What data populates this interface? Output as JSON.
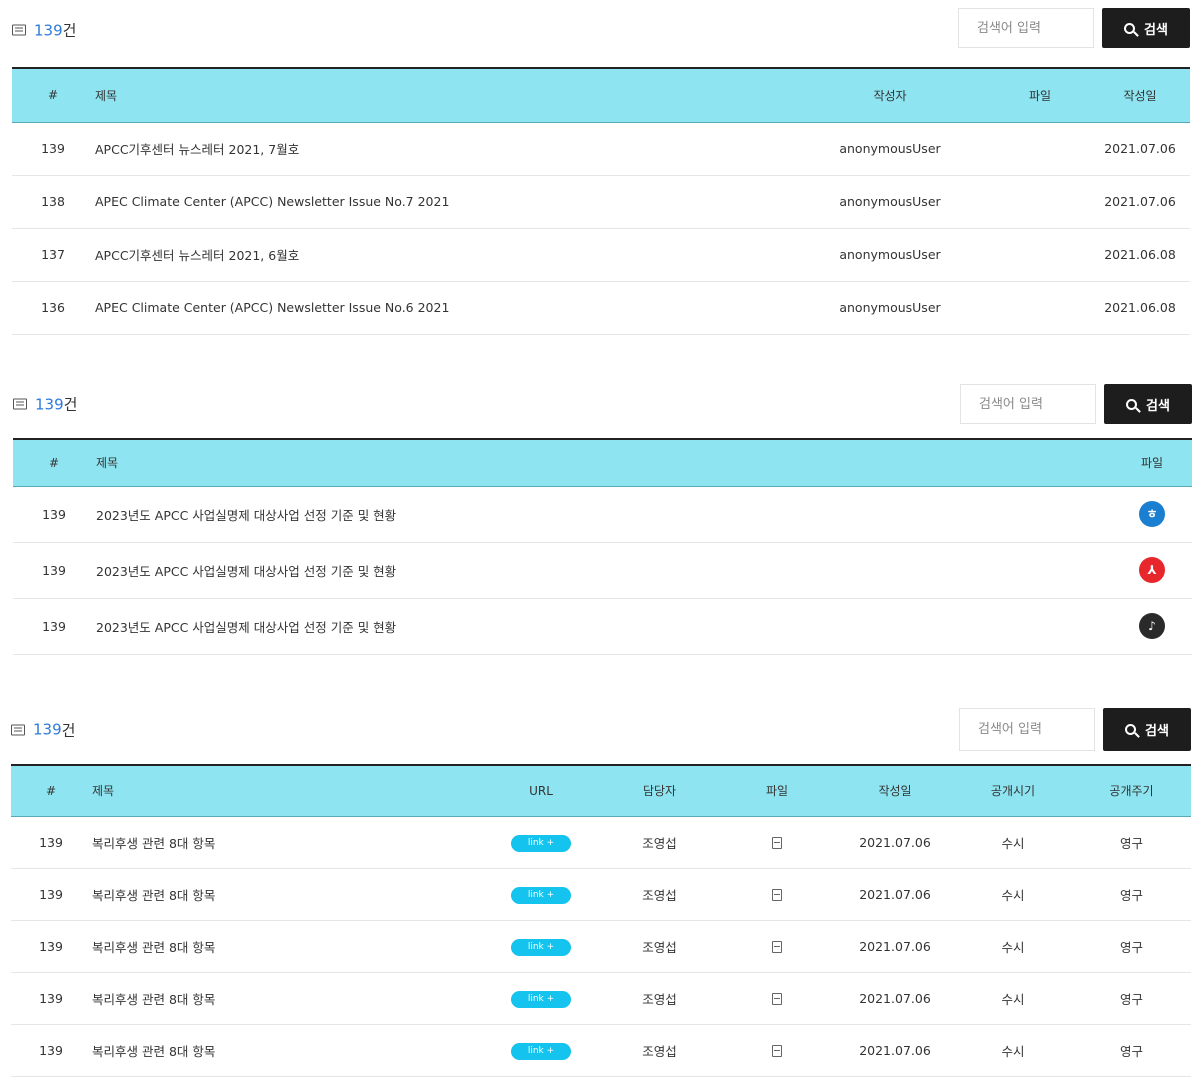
{
  "boards": [
    {
      "count": "139",
      "count_suffix": "건",
      "search_placeholder": "검색어 입력",
      "search_button": "검색",
      "headers": [
        "#",
        "제목",
        "작성자",
        "파일",
        "작성일"
      ],
      "rows": [
        {
          "no": "139",
          "title": "APCC기후센터 뉴스레터 2021, 7월호",
          "author": "anonymousUser",
          "file": "",
          "date": "2021.07.06"
        },
        {
          "no": "138",
          "title": "APEC Climate Center (APCC) Newsletter Issue No.7 2021",
          "author": "anonymousUser",
          "file": "",
          "date": "2021.07.06"
        },
        {
          "no": "137",
          "title": "APCC기후센터 뉴스레터 2021, 6월호",
          "author": "anonymousUser",
          "file": "",
          "date": "2021.06.08"
        },
        {
          "no": "136",
          "title": "APEC Climate Center (APCC) Newsletter Issue No.6 2021",
          "author": "anonymousUser",
          "file": "",
          "date": "2021.06.08"
        }
      ]
    },
    {
      "count": "139",
      "count_suffix": "건",
      "search_placeholder": "검색어 입력",
      "search_button": "검색",
      "headers": [
        "#",
        "제목",
        "파일"
      ],
      "rows": [
        {
          "no": "139",
          "title": "2023년도 APCC 사업실명제 대상사업 선정 기준 및 현황",
          "file_icon": "hwp-file-icon",
          "file_color": "#1a7fd0",
          "file_glyph": "ㅎ"
        },
        {
          "no": "139",
          "title": "2023년도 APCC 사업실명제 대상사업 선정 기준 및 현황",
          "file_icon": "pdf-file-icon",
          "file_color": "#e8272c",
          "file_glyph": "⅄"
        },
        {
          "no": "139",
          "title": "2023년도 APCC 사업실명제 대상사업 선정 기준 및 현황",
          "file_icon": "mp3-file-icon",
          "file_color": "#2a2a2a",
          "file_glyph": "♪"
        }
      ]
    },
    {
      "count": "139",
      "count_suffix": "건",
      "search_placeholder": "검색어 입력",
      "search_button": "검색",
      "headers": [
        "#",
        "제목",
        "URL",
        "담당자",
        "파일",
        "작성일",
        "공개시기",
        "공개주기"
      ],
      "rows": [
        {
          "no": "139",
          "title": "복리후생 관련 8대 항목",
          "url": "link +",
          "manager": "조영섭",
          "date": "2021.07.06",
          "timing": "수시",
          "period": "영구"
        },
        {
          "no": "139",
          "title": "복리후생 관련 8대 항목",
          "url": "link +",
          "manager": "조영섭",
          "date": "2021.07.06",
          "timing": "수시",
          "period": "영구"
        },
        {
          "no": "139",
          "title": "복리후생 관련 8대 항목",
          "url": "link +",
          "manager": "조영섭",
          "date": "2021.07.06",
          "timing": "수시",
          "period": "영구"
        },
        {
          "no": "139",
          "title": "복리후생 관련 8대 항목",
          "url": "link +",
          "manager": "조영섭",
          "date": "2021.07.06",
          "timing": "수시",
          "period": "영구"
        },
        {
          "no": "139",
          "title": "복리후생 관련 8대 항목",
          "url": "link +",
          "manager": "조영섭",
          "date": "2021.07.06",
          "timing": "수시",
          "period": "영구"
        }
      ]
    }
  ]
}
